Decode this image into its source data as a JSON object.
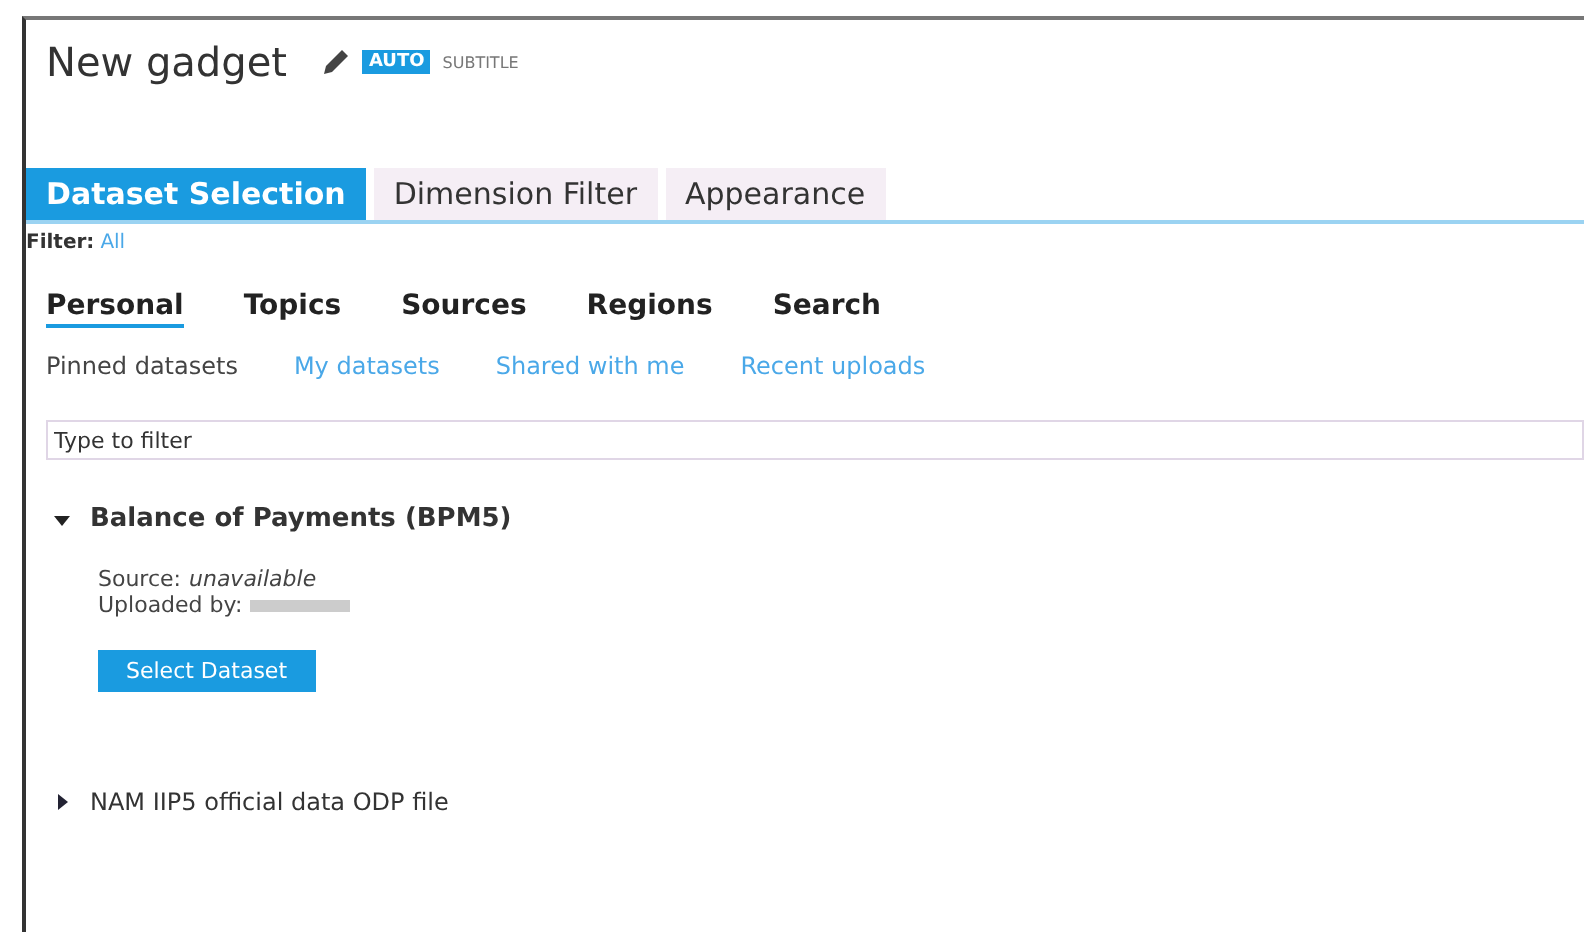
{
  "gadget": {
    "title": "New gadget",
    "badge": "AUTO",
    "subtitle": "SUBTITLE"
  },
  "tabs": [
    {
      "label": "Dataset Selection",
      "selected": true
    },
    {
      "label": "Dimension Filter",
      "selected": false
    },
    {
      "label": "Appearance",
      "selected": false
    }
  ],
  "filter": {
    "label": "Filter:",
    "value": "All"
  },
  "categories": [
    {
      "label": "Personal",
      "selected": true
    },
    {
      "label": "Topics",
      "selected": false
    },
    {
      "label": "Sources",
      "selected": false
    },
    {
      "label": "Regions",
      "selected": false
    },
    {
      "label": "Search",
      "selected": false
    }
  ],
  "sub_links": [
    {
      "label": "Pinned datasets",
      "selected": true
    },
    {
      "label": "My datasets",
      "selected": false
    },
    {
      "label": "Shared with me",
      "selected": false
    },
    {
      "label": "Recent uploads",
      "selected": false
    }
  ],
  "search": {
    "placeholder": "Type to filter"
  },
  "datasets": [
    {
      "title": "Balance of Payments (BPM5)",
      "expanded": true,
      "source_label": "Source:",
      "source_value": "unavailable",
      "uploaded_label": "Uploaded by:",
      "button": "Select Dataset"
    },
    {
      "title": "NAM IIP5 official data ODP file",
      "expanded": false
    }
  ]
}
